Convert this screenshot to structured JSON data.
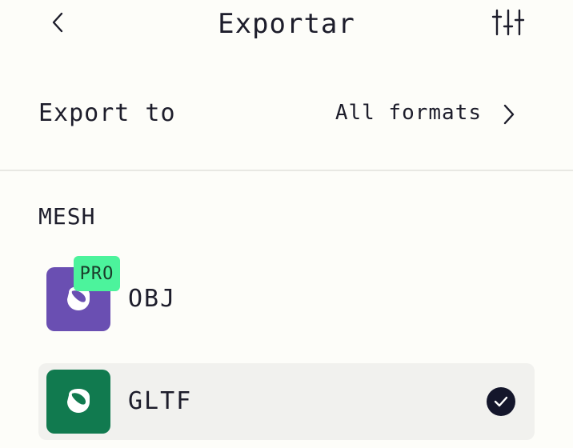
{
  "header": {
    "title": "Exportar",
    "back_icon": "chevron-left-icon",
    "filter_icon": "sliders-icon"
  },
  "export_to": {
    "label": "Export to",
    "value": "All formats",
    "chevron_icon": "chevron-right-icon"
  },
  "section": {
    "title": "MESH"
  },
  "formats": [
    {
      "name": "OBJ",
      "badge": "PRO",
      "icon_color": "#6a4fb2",
      "selected": false
    },
    {
      "name": "GLTF",
      "badge": "",
      "icon_color": "#117a4f",
      "selected": true
    }
  ],
  "colors": {
    "background": "#fdfdf9",
    "pro_badge": "#4cf39c",
    "selected_row": "#f1f1ee",
    "check": "#14162b"
  }
}
